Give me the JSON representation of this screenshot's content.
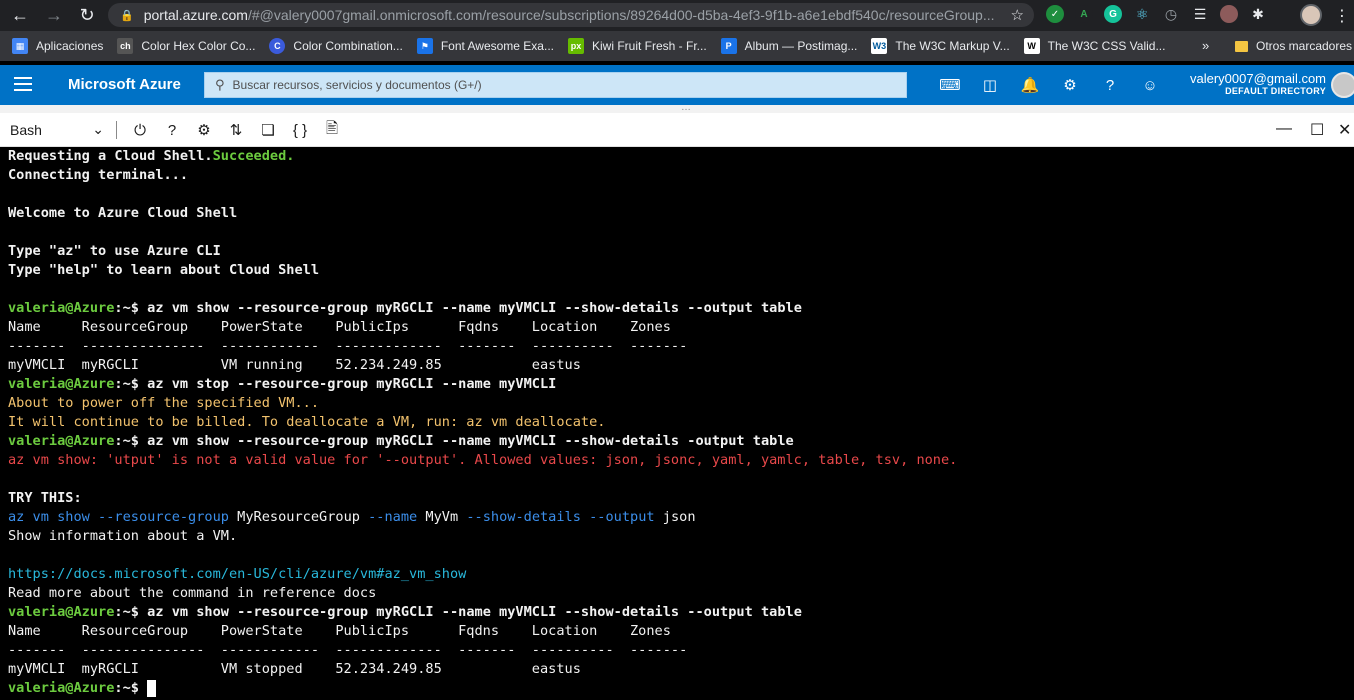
{
  "browser": {
    "url_host": "portal.azure.com",
    "url_rest": "/#@valery0007gmail.onmicrosoft.com/resource/subscriptions/89264d00-d5ba-4ef3-9f1b-a6e1ebdf540c/resourceGroup...",
    "bookmarks": [
      {
        "label": "Aplicaciones",
        "icon": "apps-grid-icon",
        "color": "#4285f4"
      },
      {
        "label": "Color Hex Color Co...",
        "icon": "colorhex-icon",
        "color": "#666666"
      },
      {
        "label": "Color Combination...",
        "icon": "color-combination-icon",
        "color": "#3b5bdb"
      },
      {
        "label": "Font Awesome Exa...",
        "icon": "flag-icon",
        "color": "#1a73e8"
      },
      {
        "label": "Kiwi Fruit Fresh - Fr...",
        "icon": "px-icon",
        "color": "#66bb00"
      },
      {
        "label": "Album — Postimag...",
        "icon": "postimage-icon",
        "color": "#1a73e8"
      },
      {
        "label": "The W3C Markup V...",
        "icon": "w3c-icon",
        "color": "#ffffff"
      },
      {
        "label": "The W3C CSS Valid...",
        "icon": "w3c-css-icon",
        "color": "#ffffff"
      }
    ],
    "more": "»",
    "other_bookmarks": "Otros marcadores"
  },
  "azure": {
    "brand": "Microsoft Azure",
    "search_placeholder": "Buscar recursos, servicios y documentos (G+/)",
    "user_email": "valery0007@gmail.com",
    "user_directory": "DEFAULT DIRECTORY",
    "accent": "#0072c6"
  },
  "cloudshell": {
    "shell": "Bash"
  },
  "terminal": {
    "lines": [
      [
        {
          "t": "Requesting a Cloud Shell.",
          "c": "bold"
        },
        {
          "t": "Succeeded.",
          "c": "green"
        }
      ],
      [
        {
          "t": "Connecting terminal...",
          "c": "bold"
        }
      ],
      [],
      [
        {
          "t": "Welcome to Azure Cloud Shell",
          "c": "bold"
        }
      ],
      [],
      [
        {
          "t": "Type \"az\" to use Azure CLI",
          "c": "bold"
        }
      ],
      [
        {
          "t": "Type \"help\" to learn about Cloud Shell",
          "c": "bold"
        }
      ],
      [],
      [
        {
          "t": "valeria@Azure",
          "c": "green"
        },
        {
          "t": ":~$ az vm show --resource-group myRGCLI --name myVMCLI --show-details --output table",
          "c": "bold"
        }
      ],
      [
        {
          "t": "Name     ResourceGroup    PowerState    PublicIps      Fqdns    Location    Zones",
          "c": ""
        }
      ],
      [
        {
          "t": "-------  ---------------  ------------  -------------  -------  ----------  -------",
          "c": ""
        }
      ],
      [
        {
          "t": "myVMCLI  myRGCLI          VM running    52.234.249.85           eastus",
          "c": ""
        }
      ],
      [
        {
          "t": "valeria@Azure",
          "c": "green"
        },
        {
          "t": ":~$ az vm stop --resource-group myRGCLI --name myVMCLI",
          "c": "bold"
        }
      ],
      [
        {
          "t": "About to power off the specified VM...",
          "c": "orange"
        }
      ],
      [
        {
          "t": "It will continue to be billed. To deallocate a VM, run: az vm deallocate.",
          "c": "orange"
        }
      ],
      [
        {
          "t": "valeria@Azure",
          "c": "green"
        },
        {
          "t": ":~$ az vm show --resource-group myRGCLI --name myVMCLI --show-details -output table",
          "c": "bold"
        }
      ],
      [
        {
          "t": "az vm show: 'utput' is not a valid value for '--output'. Allowed values: json, jsonc, yaml, yamlc, table, tsv, none.",
          "c": "red"
        }
      ],
      [],
      [
        {
          "t": "TRY THIS:",
          "c": "bold"
        }
      ],
      [
        {
          "t": "az vm show ",
          "c": "blue"
        },
        {
          "t": "--resource-group ",
          "c": "blue"
        },
        {
          "t": "MyResourceGroup ",
          "c": ""
        },
        {
          "t": "--name ",
          "c": "blue"
        },
        {
          "t": "MyVm ",
          "c": ""
        },
        {
          "t": "--show-details ",
          "c": "blue"
        },
        {
          "t": "--output ",
          "c": "blue"
        },
        {
          "t": "json",
          "c": ""
        }
      ],
      [
        {
          "t": "Show information about a VM.",
          "c": ""
        }
      ],
      [],
      [
        {
          "t": "https://docs.microsoft.com/en-US/cli/azure/vm#az_vm_show",
          "c": "cyan"
        }
      ],
      [
        {
          "t": "Read more about the command in reference docs",
          "c": ""
        }
      ],
      [
        {
          "t": "valeria@Azure",
          "c": "green"
        },
        {
          "t": ":~$ az vm show --resource-group myRGCLI --name myVMCLI --show-details --output table",
          "c": "bold"
        }
      ],
      [
        {
          "t": "Name     ResourceGroup    PowerState    PublicIps      Fqdns    Location    Zones",
          "c": ""
        }
      ],
      [
        {
          "t": "-------  ---------------  ------------  -------------  -------  ----------  -------",
          "c": ""
        }
      ],
      [
        {
          "t": "myVMCLI  myRGCLI          VM stopped    52.234.249.85           eastus",
          "c": ""
        }
      ],
      [
        {
          "t": "valeria@Azure",
          "c": "green"
        },
        {
          "t": ":~$ ",
          "c": "bold"
        }
      ]
    ]
  }
}
